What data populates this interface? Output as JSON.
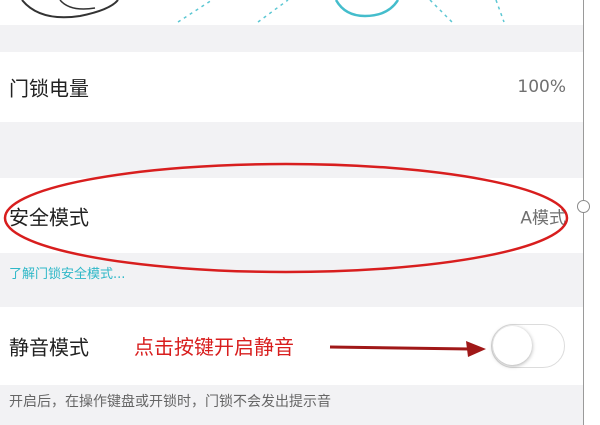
{
  "settings": {
    "battery": {
      "label": "门锁电量",
      "value": "100%"
    },
    "safety_mode": {
      "label": "安全模式",
      "value": "A模式",
      "help_link": "了解门锁安全模式..."
    },
    "mute_mode": {
      "label": "静音模式",
      "enabled": false,
      "description": "开启后，在操作键盘或开锁时，门锁不会发出提示音"
    }
  },
  "annotation": {
    "text": "点击按键开启静音",
    "color": "#d81e1e"
  },
  "colors": {
    "accent": "#2fb8c8",
    "background": "#f2f2f4",
    "annotation_red": "#d81e1e"
  }
}
